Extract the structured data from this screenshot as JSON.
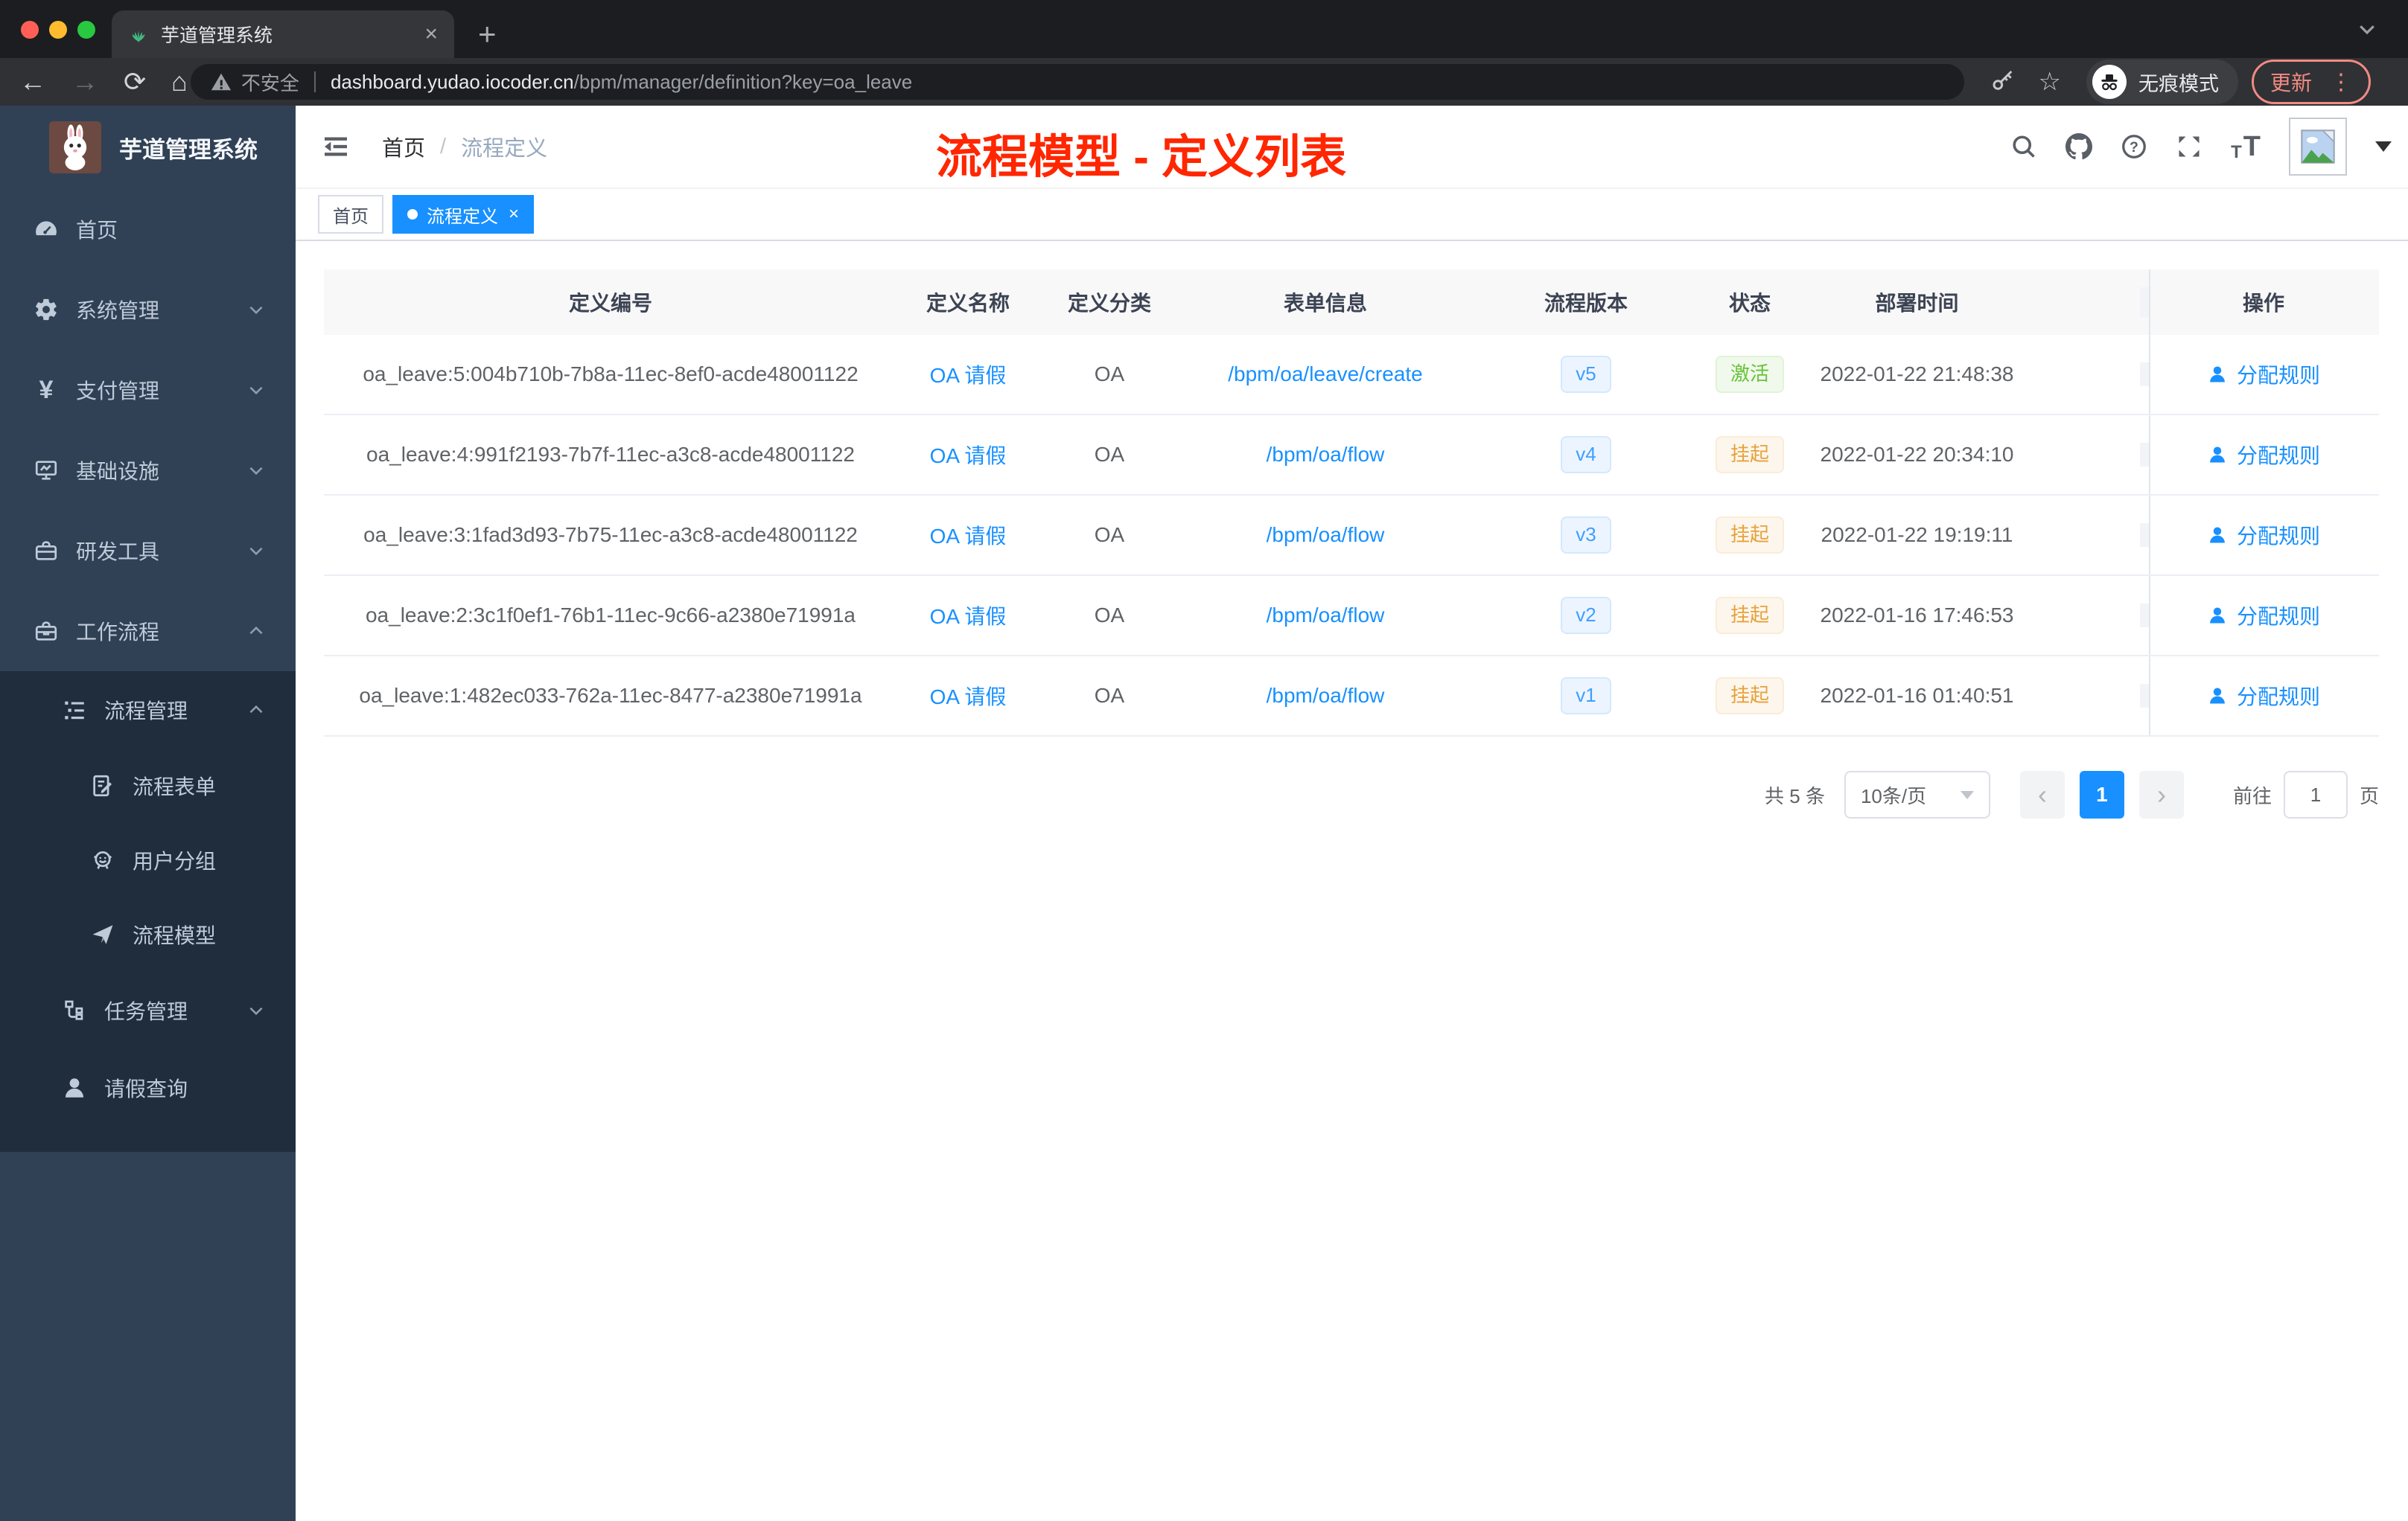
{
  "colors": {
    "accent_blue": "#1890ff",
    "element_blue": "#409eff",
    "success_green": "#67c23a",
    "warning_orange": "#e6a23c",
    "annotation_red": "#ff2600",
    "sidebar_bg": "#304156",
    "submenu_bg": "#1f2d3d",
    "chrome_bg": "#1c1d20",
    "update_pink": "#f28b82",
    "traffic_lights": [
      "#ff5f57",
      "#febc2e",
      "#28c840"
    ]
  },
  "glyphs": {
    "back": "←",
    "forward": "→",
    "reload": "⟳",
    "home": "⌂",
    "star": "☆",
    "more": "⋮",
    "close": "×",
    "new_tab": "+",
    "prev": "‹",
    "next": "›",
    "yen": "¥",
    "question": "?",
    "font_small": "T",
    "font_large": "T"
  },
  "browser": {
    "tab_title": "芋道管理系统",
    "security_label": "不安全",
    "url_host": "dashboard.yudao.iocoder.cn",
    "url_path": "/bpm/manager/definition?key=oa_leave",
    "incognito_label": "无痕模式",
    "update_label": "更新"
  },
  "sidebar": {
    "title": "芋道管理系统",
    "items": [
      "首页",
      "系统管理",
      "支付管理",
      "基础设施",
      "研发工具",
      "工作流程",
      "流程管理",
      "流程表单",
      "用户分组",
      "流程模型",
      "任务管理",
      "请假查询"
    ]
  },
  "navbar": {
    "breadcrumb_home": "首页",
    "breadcrumb_separator": "/",
    "breadcrumb_current": "流程定义",
    "annotation": "流程模型 - 定义列表"
  },
  "tags": {
    "home": "首页",
    "active": "流程定义"
  },
  "table": {
    "columns": [
      "定义编号",
      "定义名称",
      "定义分类",
      "表单信息",
      "流程版本",
      "状态",
      "部署时间",
      "操作"
    ],
    "action_label": "分配规则",
    "rows": [
      {
        "id": "oa_leave:5:004b710b-7b8a-11ec-8ef0-acde48001122",
        "name": "OA 请假",
        "category": "OA",
        "form": "/bpm/oa/leave/create",
        "version": "v5",
        "status": "激活",
        "time": "2022-01-22 21:48:38"
      },
      {
        "id": "oa_leave:4:991f2193-7b7f-11ec-a3c8-acde48001122",
        "name": "OA 请假",
        "category": "OA",
        "form": "/bpm/oa/flow",
        "version": "v4",
        "status": "挂起",
        "time": "2022-01-22 20:34:10"
      },
      {
        "id": "oa_leave:3:1fad3d93-7b75-11ec-a3c8-acde48001122",
        "name": "OA 请假",
        "category": "OA",
        "form": "/bpm/oa/flow",
        "version": "v3",
        "status": "挂起",
        "time": "2022-01-22 19:19:11"
      },
      {
        "id": "oa_leave:2:3c1f0ef1-76b1-11ec-9c66-a2380e71991a",
        "name": "OA 请假",
        "category": "OA",
        "form": "/bpm/oa/flow",
        "version": "v2",
        "status": "挂起",
        "time": "2022-01-16 17:46:53"
      },
      {
        "id": "oa_leave:1:482ec033-762a-11ec-8477-a2380e71991a",
        "name": "OA 请假",
        "category": "OA",
        "form": "/bpm/oa/flow",
        "version": "v1",
        "status": "挂起",
        "time": "2022-01-16 01:40:51"
      }
    ]
  },
  "pagination": {
    "total": "共 5 条",
    "page_size": "10条/页",
    "current": "1",
    "goto_label": "前往",
    "unit_label": "页",
    "input_value": "1"
  }
}
